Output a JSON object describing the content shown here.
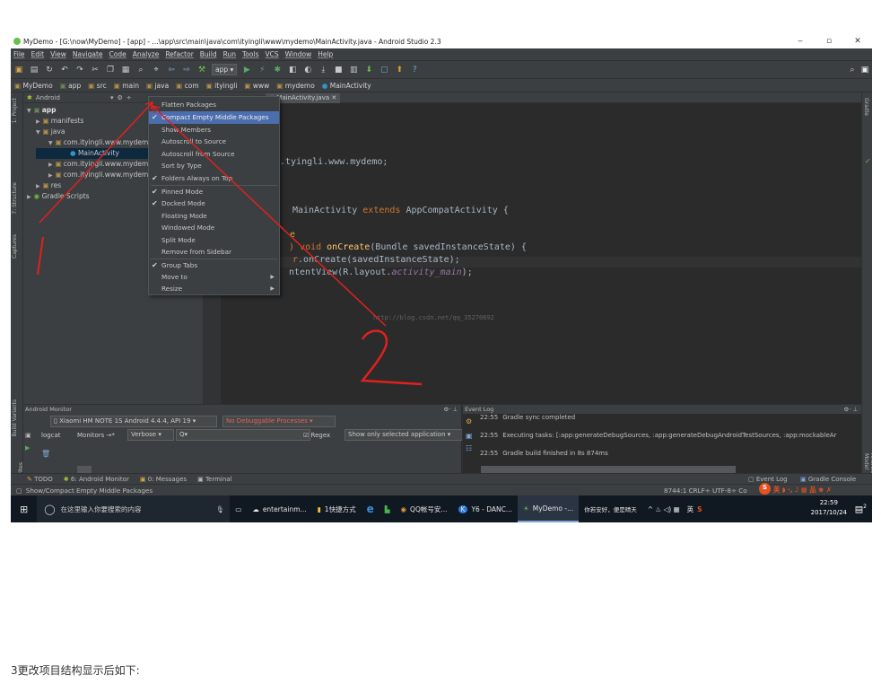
{
  "window": {
    "title": "MyDemo - [G:\\now\\MyDemo] - [app] - ...\\app\\src\\main\\java\\com\\ityingli\\www\\mydemo\\MainActivity.java - Android Studio 2.3",
    "minimize": "‒",
    "maximize": "▫",
    "close": "✕"
  },
  "menubar": [
    "File",
    "Edit",
    "View",
    "Navigate",
    "Code",
    "Analyze",
    "Refactor",
    "Build",
    "Run",
    "Tools",
    "VCS",
    "Window",
    "Help"
  ],
  "toolbar": {
    "run_config": "app"
  },
  "navbar": {
    "items": [
      "MyDemo",
      "app",
      "src",
      "main",
      "java",
      "com",
      "ityingli",
      "www",
      "mydemo",
      "MainActivity"
    ]
  },
  "left_stripe": {
    "tabs": [
      "1: Project",
      "7: Structure",
      "Captures",
      "Build Variants",
      "2: Favorites"
    ]
  },
  "right_stripe": {
    "tabs": [
      "Gradle",
      "Android Model"
    ]
  },
  "project_panel": {
    "view_selector": "Android",
    "tree": [
      {
        "label": "app",
        "arrow": "▼"
      },
      {
        "label": "manifests",
        "arrow": "▶"
      },
      {
        "label": "java",
        "arrow": "▼"
      },
      {
        "label": "com.ityingli.www.mydem",
        "arrow": "▼"
      },
      {
        "label": "MainActivity",
        "arrow": ""
      },
      {
        "label": "com.ityingli.www.mydem",
        "arrow": "▶"
      },
      {
        "label": "com.ityingli.www.mydem",
        "arrow": "▶"
      },
      {
        "label": "res",
        "arrow": "▶"
      },
      {
        "label": "Gradle Scripts",
        "arrow": "▶"
      }
    ]
  },
  "editor": {
    "tab": "MainActivity.java",
    "code": {
      "l1": ".tyingli.www.mydemo;",
      "l2_a": "MainActivity ",
      "l2_kw": "extends",
      "l2_b": " AppCompatActivity {",
      "l3_kw": "void",
      "l3_fn": " onCreate",
      "l3_b": "(Bundle savedInstanceState) {",
      "l4": ".onCreate(savedInstanceState);",
      "l5_a": "ntentView(R.layout.",
      "l5_it": "activity_main",
      "l5_b": ");"
    },
    "watermark": "http://blog.csdn.net/qq_35270692"
  },
  "popup_menu": {
    "items": [
      {
        "label": "Flatten Packages",
        "checked": ""
      },
      {
        "label": "Compact Empty Middle Packages",
        "checked": "✔"
      },
      {
        "label": "Show Members",
        "checked": ""
      },
      {
        "label": "Autoscroll to Source",
        "checked": ""
      },
      {
        "label": "Autoscroll from Source",
        "checked": ""
      },
      {
        "label": "Sort by Type",
        "checked": ""
      },
      {
        "label": "Folders Always on Top",
        "checked": "✔"
      },
      {
        "label": "Pinned Mode",
        "checked": "✔"
      },
      {
        "label": "Docked Mode",
        "checked": "✔"
      },
      {
        "label": "Floating Mode",
        "checked": ""
      },
      {
        "label": "Windowed Mode",
        "checked": ""
      },
      {
        "label": "Split Mode",
        "checked": ""
      },
      {
        "label": "Remove from Sidebar",
        "checked": ""
      },
      {
        "label": "Group Tabs",
        "checked": "✔"
      },
      {
        "label": "Move to",
        "checked": "",
        "submenu": "▶"
      },
      {
        "label": "Resize",
        "checked": "",
        "submenu": "▶"
      }
    ]
  },
  "android_monitor": {
    "title": "Android Monitor",
    "device": "Xiaomi HM NOTE 1S Android 4.4.4, API 19",
    "process": "No Debuggable Processes",
    "tabs": [
      "logcat",
      "Monitors →*"
    ],
    "level": "Verbose",
    "search": "Q▾",
    "regex": "Regex",
    "filter": "Show only selected application"
  },
  "event_log": {
    "title": "Event Log",
    "entries": [
      {
        "time": "22:55",
        "text": "Gradle sync completed"
      },
      {
        "time": "22:55",
        "text": "Executing tasks: [:app:generateDebugSources, :app:generateDebugAndroidTestSources, :app:mockableAr"
      },
      {
        "time": "22:55",
        "text": "Gradle build finished in 8s 874ms"
      }
    ]
  },
  "tool_tabs": [
    "TODO",
    "6: Android Monitor",
    "0: Messages",
    "Terminal",
    "Event Log",
    "Gradle Console"
  ],
  "statusbar": {
    "message": "Show/Compact Empty Middle Packages",
    "position": "8744:1  CRLF÷  UTF-8÷  Co"
  },
  "taskbar": {
    "search_placeholder": "在这里输入你要搜索的内容",
    "items": [
      "entertainm...",
      "1快捷方式",
      "QQ帐号安...",
      "Y6 - DANC...",
      "MyDemo -..."
    ],
    "notice": "你若安好，便是晴天",
    "lang": "英",
    "time": "22:59",
    "date": "2017/10/24",
    "badge": "2"
  },
  "annotations": {
    "one": "1",
    "two": "2"
  },
  "caption": "3更改项目结构显示后如下:",
  "colors": {
    "accent": "#4b6eaf",
    "arrow": "#e02020"
  }
}
